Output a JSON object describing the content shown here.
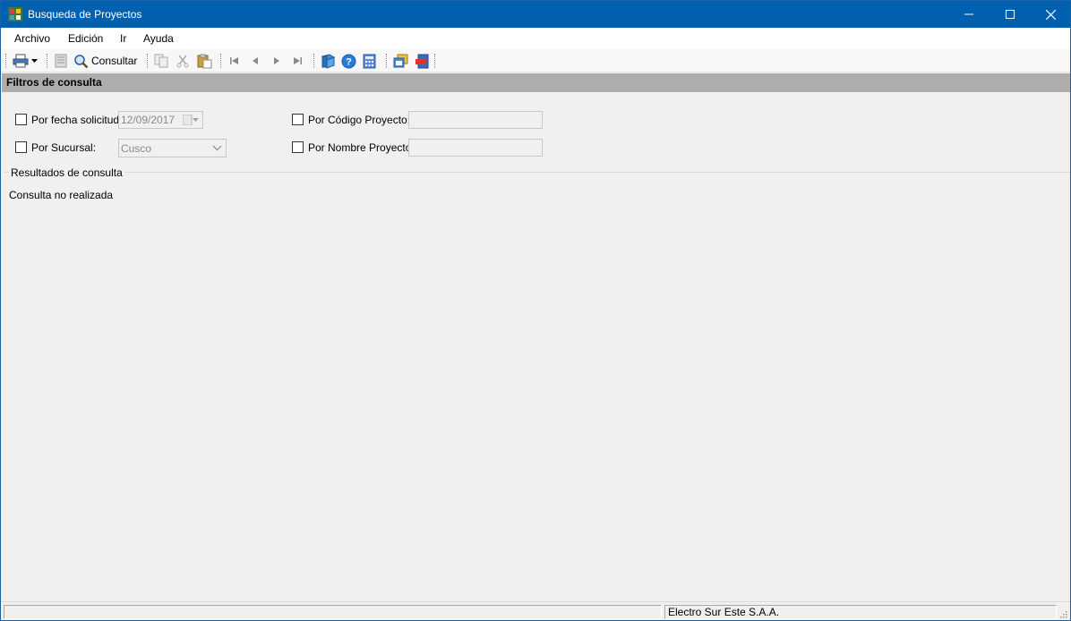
{
  "window": {
    "title": "Busqueda de Proyectos",
    "title_bar_color": "#0060b0"
  },
  "menu": {
    "items": [
      "Archivo",
      "Edición",
      "Ir",
      "Ayuda"
    ]
  },
  "toolbar": {
    "print_icon": "printer-icon",
    "consultar_label": "Consultar",
    "icons": [
      "printer-icon",
      "dropdown-arrow-icon",
      "report-icon",
      "search-icon",
      "copy-icon",
      "cut-icon",
      "paste-icon",
      "first-record-icon",
      "previous-record-icon",
      "next-record-icon",
      "last-record-icon",
      "help-book-icon",
      "help-circle-icon",
      "calculator-icon",
      "window-switch-icon",
      "exit-icon"
    ]
  },
  "filters": {
    "header": "Filtros de consulta",
    "fecha": {
      "label": "Por fecha solicitud:",
      "value": "12/09/2017",
      "checked": false
    },
    "sucursal": {
      "label": "Por Sucursal:",
      "value": "Cusco",
      "checked": false
    },
    "codigo": {
      "label": "Por Código Proyecto:",
      "value": "",
      "checked": false
    },
    "nombre": {
      "label": "Por Nombre Proyecto:",
      "value": "",
      "checked": false
    }
  },
  "results": {
    "legend": "Resultados de consulta",
    "message": "Consulta no realizada"
  },
  "statusbar": {
    "left_text": "",
    "company": "Electro Sur Este S.A.A."
  }
}
